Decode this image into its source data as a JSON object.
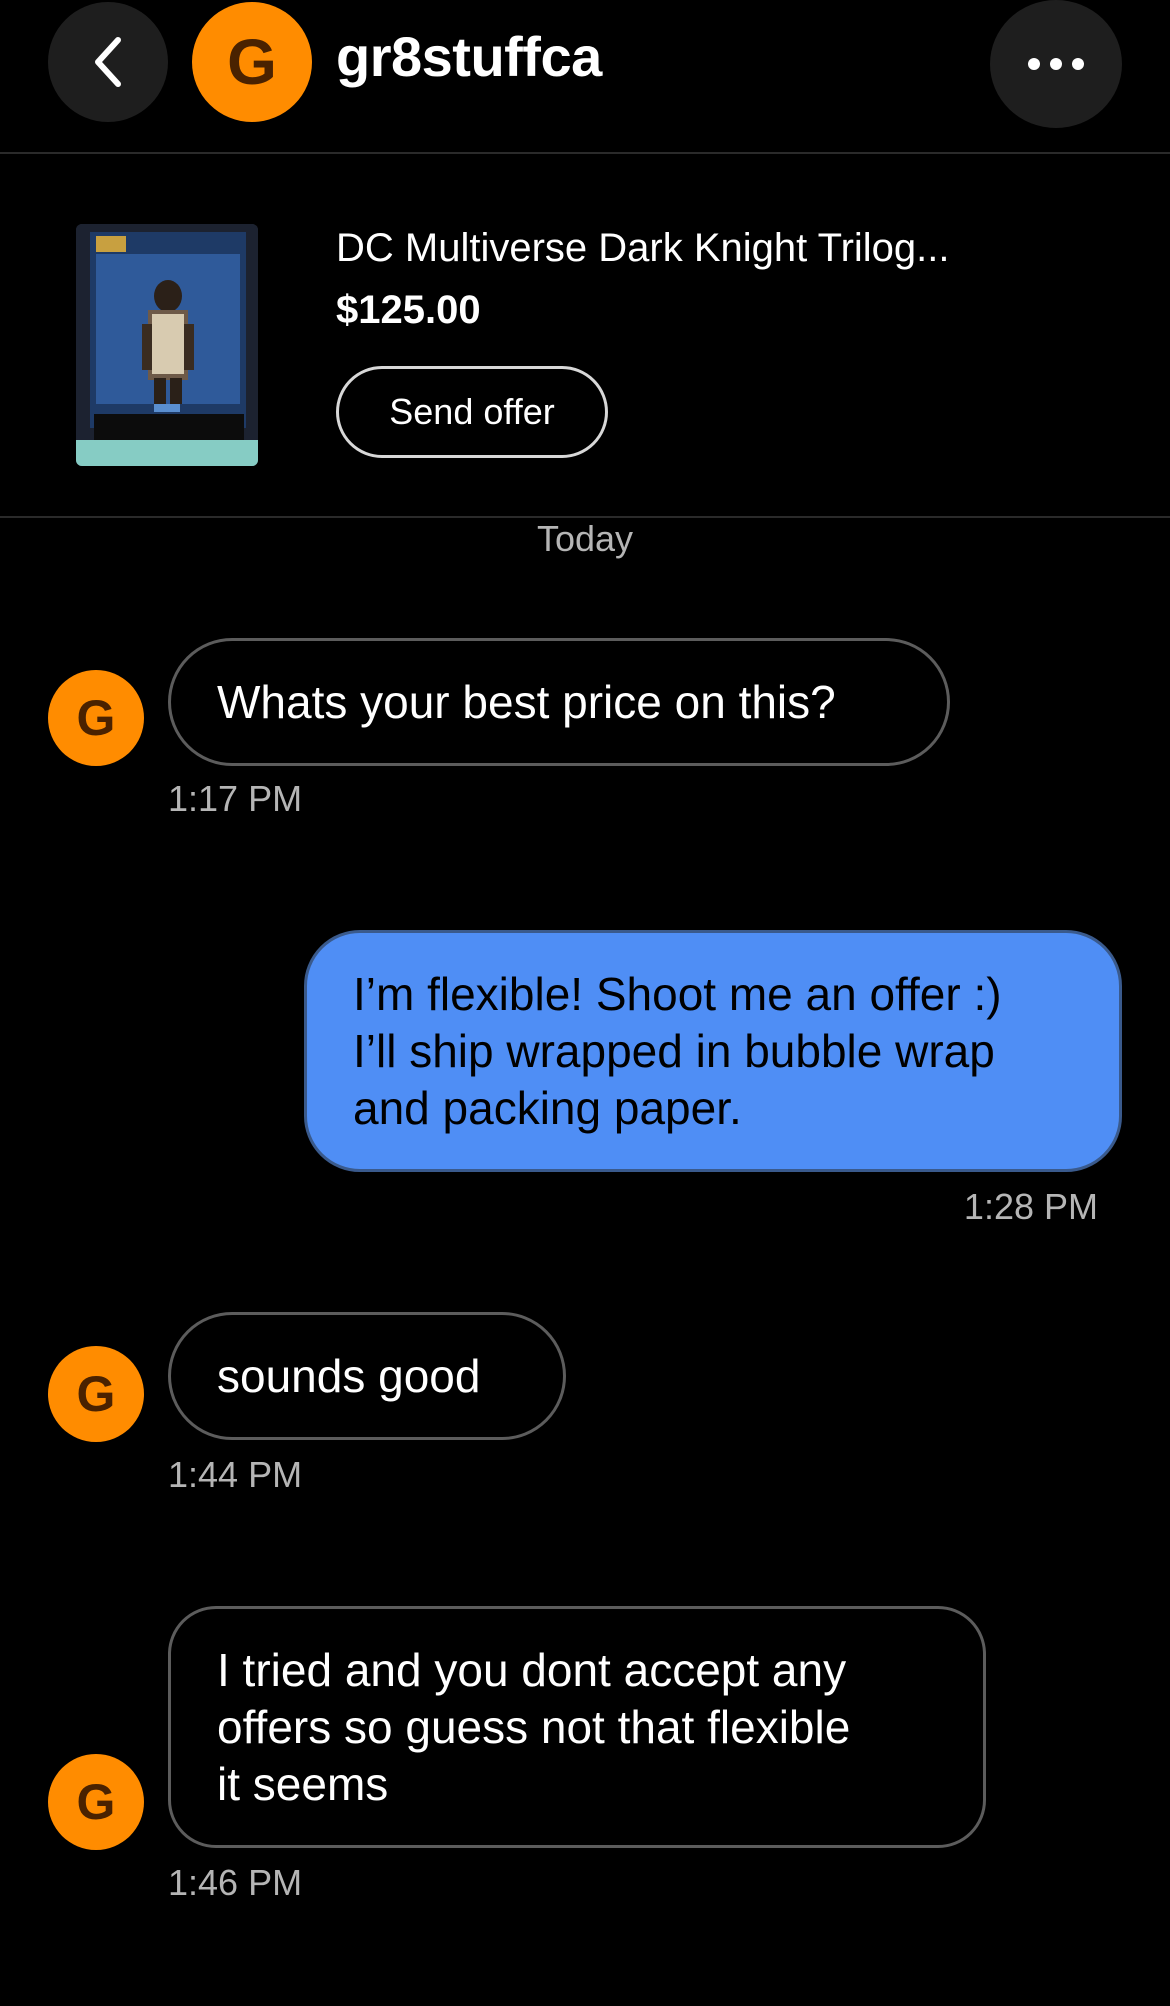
{
  "header": {
    "back_icon": "chevron-left-icon",
    "avatar_letter": "G",
    "username": "gr8stuffca",
    "more_icon": "more-horizontal-icon"
  },
  "listing": {
    "title": "DC Multiverse Dark Knight Trilog...",
    "price": "$125.00",
    "offer_button": "Send offer"
  },
  "day_label": "Today",
  "messages": [
    {
      "from": "them",
      "text": "Whats your best price on this?",
      "time": "1:17 PM"
    },
    {
      "from": "me",
      "text": "I’m flexible! Shoot me an offer :)\nI’ll ship wrapped in bubble wrap\nand packing paper.",
      "time": "1:28 PM"
    },
    {
      "from": "them",
      "text": "sounds good",
      "time": "1:44 PM"
    },
    {
      "from": "them",
      "text": "I tried and you dont accept any\noffers so guess not that flexible\nit seems",
      "time": "1:46 PM"
    }
  ],
  "avatar_letter": "G",
  "colors": {
    "avatar": "#ff8c00",
    "outgoing_bubble": "#4f8ef5",
    "background": "#000000"
  }
}
